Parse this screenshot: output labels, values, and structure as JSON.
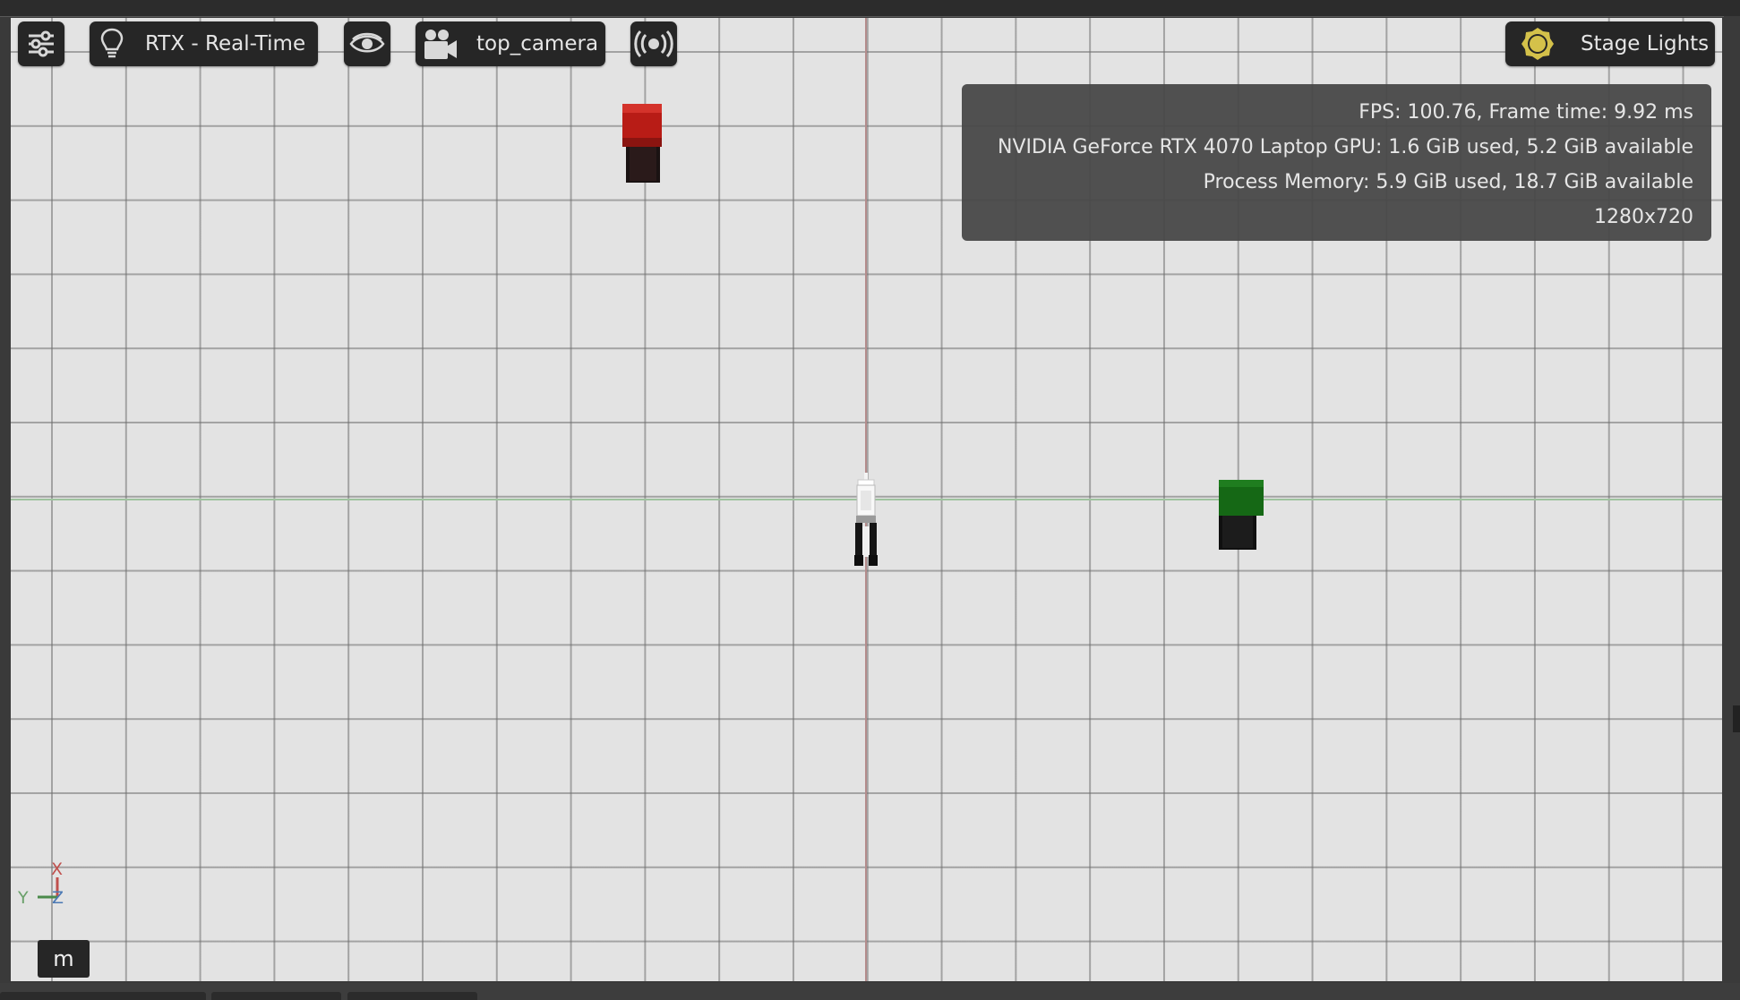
{
  "toolbar": {
    "settings_icon": "sliders-icon",
    "renderer": {
      "icon": "lightbulb-icon",
      "label": "RTX - Real-Time"
    },
    "visibility_icon": "eye-icon",
    "camera": {
      "icon": "movie-camera-icon",
      "label": "top_camera"
    },
    "sensor_icon": "broadcast-icon",
    "lighting": {
      "icon": "sun-icon",
      "label": "Stage Lights"
    }
  },
  "stats": {
    "fps": "FPS: 100.76, Frame time: 9.92 ms",
    "gpu": "NVIDIA GeForce RTX 4070 Laptop GPU: 1.6 GiB used, 5.2 GiB available",
    "memory": "Process Memory: 5.9 GiB used, 18.7 GiB available",
    "resolution": "1280x720"
  },
  "gizmo": {
    "x_label": "X",
    "y_label": "Y",
    "z_label": "Z"
  },
  "unit": {
    "label": "m"
  },
  "colors": {
    "grid_background": "#e3e3e3",
    "x_axis": "#c0504d",
    "y_axis": "#4a8a4a",
    "z_axis": "#4a78b4",
    "red_cube": "#c0201a",
    "green_cube": "#146414",
    "sun_icon": "#d4c14a"
  }
}
